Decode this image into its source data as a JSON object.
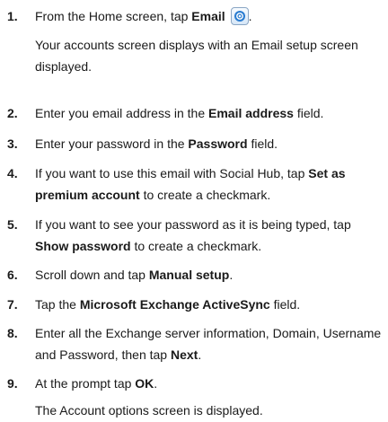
{
  "steps": [
    {
      "num": "1.",
      "pre": "From the Home screen, tap ",
      "b1": "Email",
      "post": "",
      "icon": "email-app-icon",
      "tail": "."
    },
    {
      "num": "2.",
      "pre": "Enter you email address in the ",
      "b1": "Email address",
      "post": " field."
    },
    {
      "num": "3.",
      "pre": "Enter your password in the ",
      "b1": "Password",
      "post": " field."
    },
    {
      "num": "4.",
      "pre": "If you want to use this email with Social Hub, tap ",
      "b1": "Set as premium account",
      "post": " to create a checkmark."
    },
    {
      "num": "5.",
      "pre": "If you want to see your password as it is being typed, tap ",
      "b1": "Show password",
      "post": " to create a checkmark."
    },
    {
      "num": "6.",
      "pre": "Scroll down and tap ",
      "b1": "Manual setup",
      "post": "."
    },
    {
      "num": "7.",
      "pre": "Tap the ",
      "b1": "Microsoft Exchange ActiveSync",
      "post": " field."
    },
    {
      "num": "8.",
      "pre": "Enter all the Exchange server information, Domain, Username and Password, then tap ",
      "b1": "Next",
      "post": "."
    },
    {
      "num": "9.",
      "pre": "At the prompt tap ",
      "b1": "OK",
      "post": "."
    }
  ],
  "notes": {
    "after_1": "Your accounts screen displays with an Email setup screen displayed.",
    "after_9": "The Account options screen is displayed."
  }
}
